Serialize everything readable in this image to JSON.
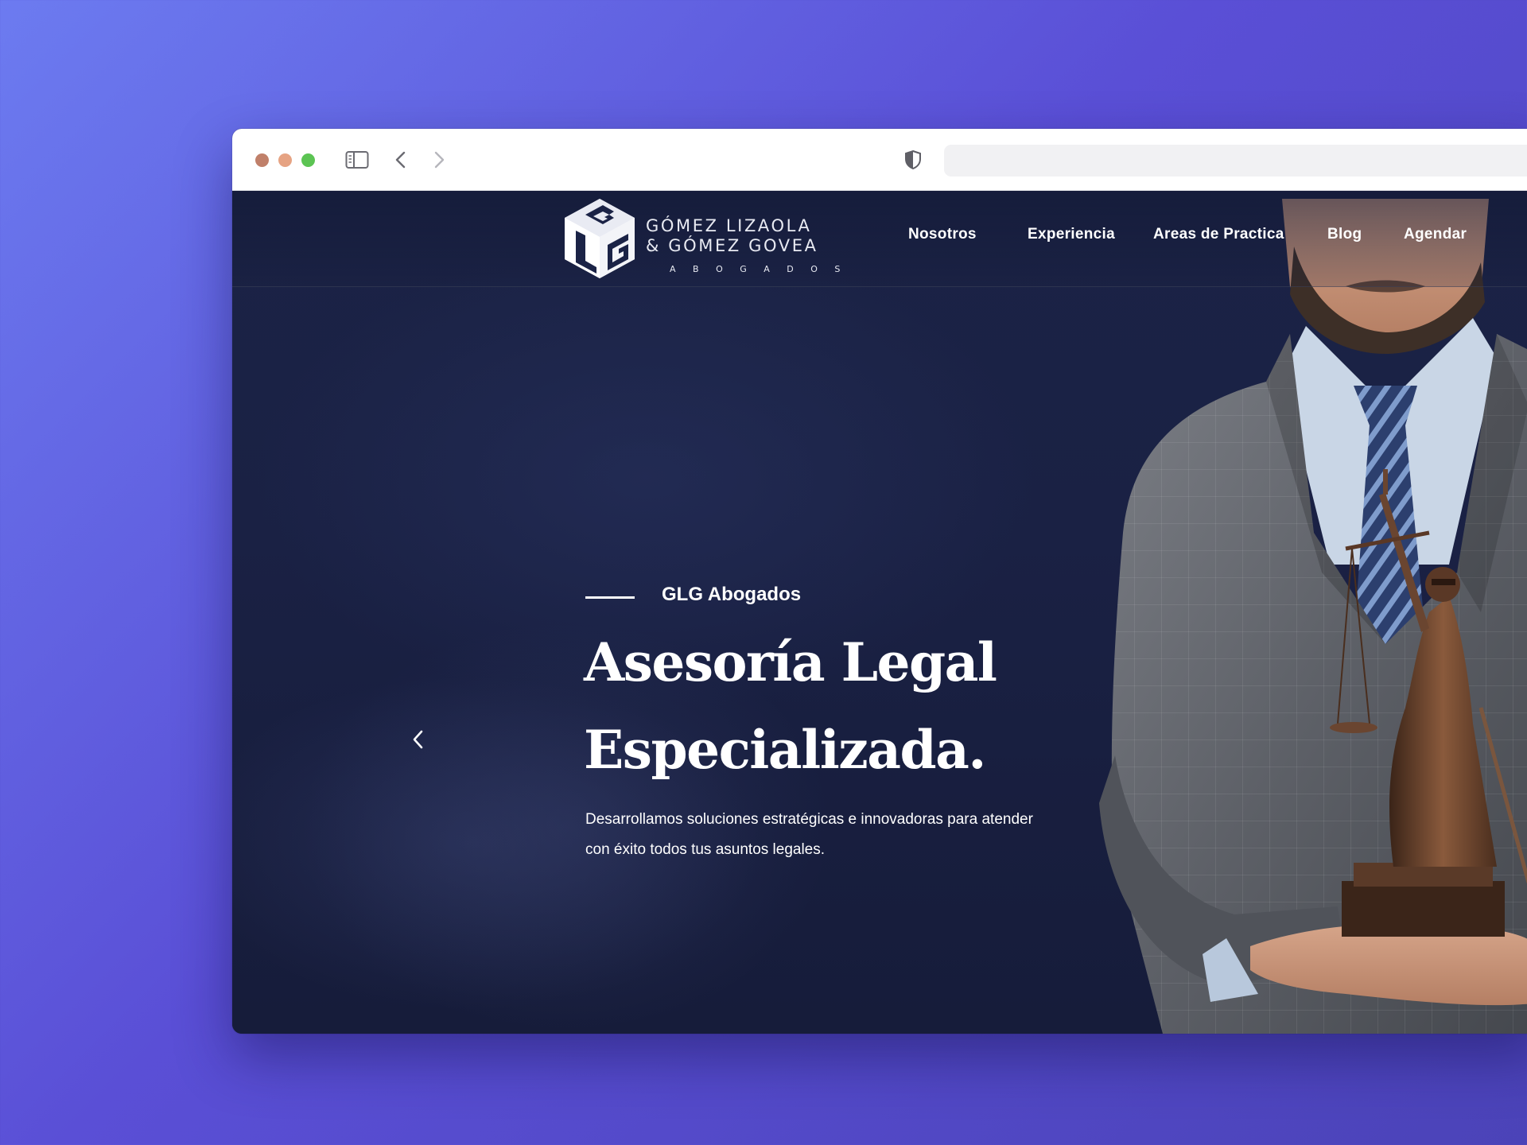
{
  "browser": {
    "traffic_lights": {
      "close": "#c0806a",
      "minimize": "#e6a383",
      "maximize": "#5cc453"
    },
    "icons": [
      "sidebar-toggle-icon",
      "back-arrow-icon",
      "forward-arrow-icon",
      "shield-icon"
    ],
    "url": ""
  },
  "logo": {
    "line1": "GÓMEZ LIZAOLA",
    "line2": "& GÓMEZ GOVEA",
    "line3": "A B O G A D O S",
    "mark_letters": "LGG"
  },
  "nav": {
    "items": [
      {
        "label": "Nosotros"
      },
      {
        "label": "Experiencia"
      },
      {
        "label": "Areas de Practica"
      },
      {
        "label": "Blog"
      },
      {
        "label": "Agendar"
      }
    ]
  },
  "hero": {
    "eyebrow": "GLG Abogados",
    "headline_line1": "Asesoría Legal",
    "headline_line2": "Especializada.",
    "description": "Desarrollamos soluciones estratégicas e innovadoras para atender con  éxito todos tus asuntos legales.",
    "prev_icon": "chevron-left-icon"
  },
  "colors": {
    "page_background": "#1a2144",
    "text": "#ffffff",
    "desktop_gradient_start": "#6c7bf0",
    "desktop_gradient_end": "#4b43b8"
  }
}
